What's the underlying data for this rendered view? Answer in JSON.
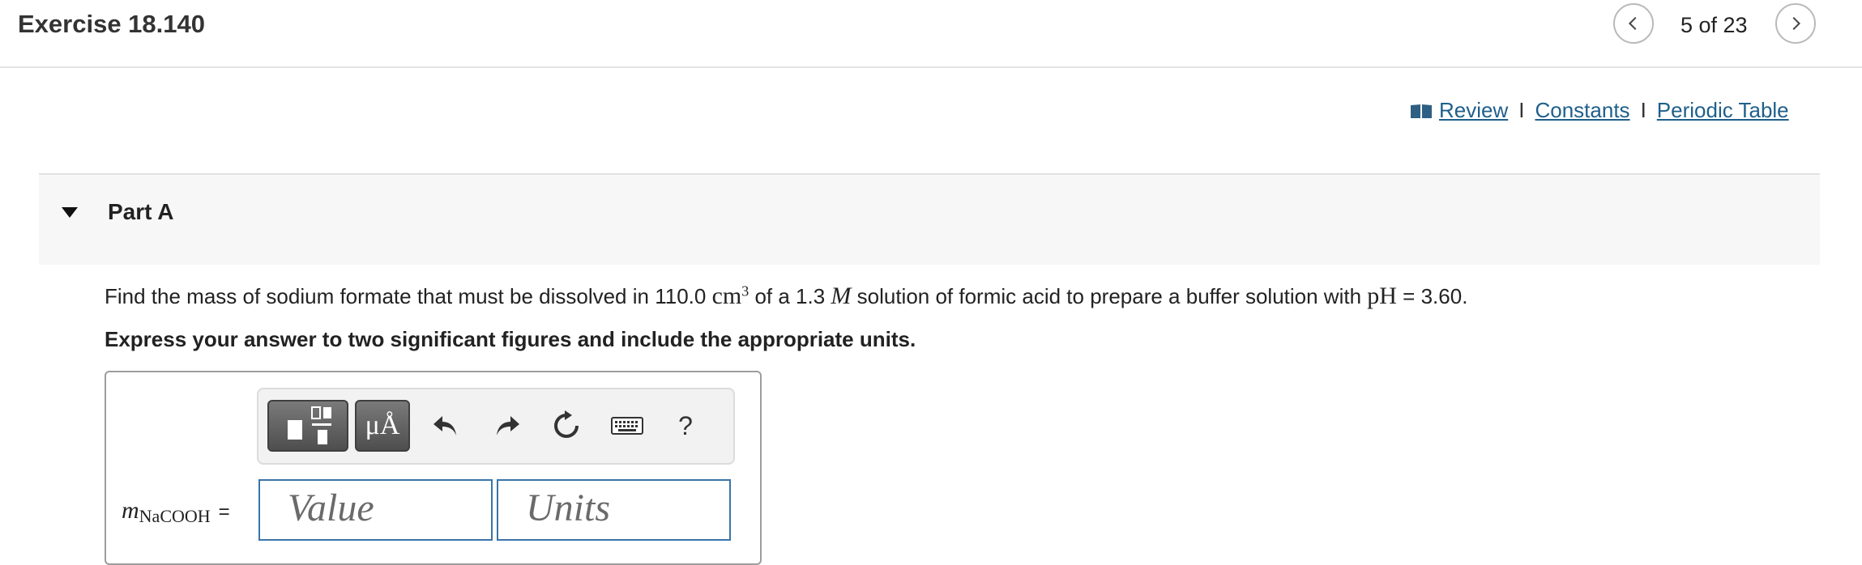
{
  "header": {
    "title": "Exercise 18.140",
    "pager": "5 of 23",
    "prev_icon": "chevron-left-icon",
    "next_icon": "chevron-right-icon"
  },
  "links": {
    "book_icon": "book-icon",
    "review": "Review",
    "sep1": "I",
    "constants": "Constants",
    "sep2": "I",
    "periodic": "Periodic Table"
  },
  "part": {
    "label": "Part A",
    "collapse_icon": "triangle-down-icon"
  },
  "question": {
    "text1": "Find the mass of sodium formate that must be dissolved in 110.0 ",
    "unit": "cm",
    "exp": "3",
    "text2": " of a 1.3 ",
    "molar": "M",
    "text3": " solution of formic acid to prepare a buffer solution with ",
    "ph": "pH",
    "text4": " = 3.60."
  },
  "instruction": "Express your answer to two significant figures and include the appropriate units.",
  "toolbar": {
    "template_icon": "templates-icon",
    "mu_label": "μÅ",
    "undo_icon": "undo-icon",
    "redo_icon": "redo-icon",
    "reset_icon": "reset-icon",
    "keyboard_icon": "keyboard-icon",
    "help_label": "?"
  },
  "answer": {
    "var_main": "m",
    "var_sub": "NaCOOH",
    "equals": "=",
    "value_placeholder": "Value",
    "units_placeholder": "Units"
  },
  "colors": {
    "link": "#1f5f8b",
    "field_border": "#3a74a8",
    "button_dark": "#5a5a5a"
  }
}
